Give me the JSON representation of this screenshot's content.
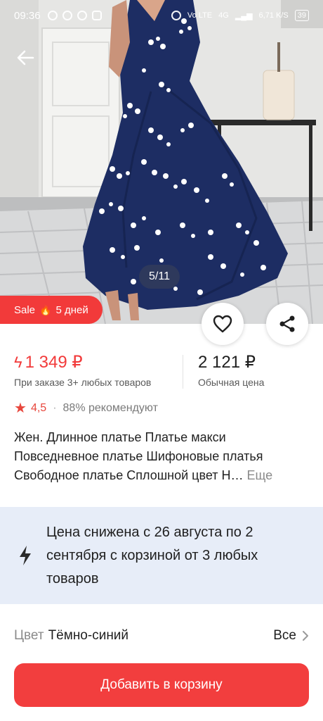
{
  "status_bar": {
    "time": "09:36",
    "network": "4G",
    "speed": "6,71",
    "speed_unit": "K/S",
    "volte": "Vo LTE",
    "battery": "39"
  },
  "gallery": {
    "counter": "5/11"
  },
  "sale_badge": {
    "label": "Sale",
    "days": "5 дней"
  },
  "prices": {
    "bulk_price": "1 349 ₽",
    "bulk_caption": "При заказе 3+ любых товаров",
    "regular_price": "2 121 ₽",
    "regular_caption": "Обычная цена"
  },
  "rating": {
    "score": "4,5",
    "recommend": "88% рекомендуют"
  },
  "product": {
    "title": "Жен. Длинное платье Платье макси Повседневное платье Шифоновые платья Свободное платье Сплошной цвет Н…",
    "more_label": "Еще"
  },
  "promo": {
    "text": "Цена снижена с 26 августа по 2 сентября с корзиной от 3 любых товаров"
  },
  "color": {
    "label": "Цвет",
    "value": "Тёмно-синий",
    "all_label": "Все"
  },
  "cart_button": {
    "label": "Добавить в корзину"
  },
  "colors": {
    "accent": "#f23a3a",
    "promo_bg": "#e7edf8",
    "dress": "#1d2d63"
  },
  "icons": [
    "back-arrow-icon",
    "heart-icon",
    "share-icon",
    "bolt-icon",
    "star-icon",
    "chevron-right-icon",
    "flame-icon"
  ]
}
